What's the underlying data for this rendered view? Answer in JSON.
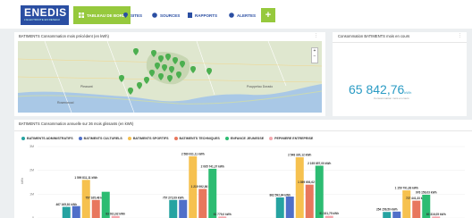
{
  "header": {
    "logo_text": "ENEDIS",
    "logo_sub": "L'ELECTRICITE EN RESEAU",
    "nav": [
      {
        "label": "TABLEAU DE BORD",
        "active": true
      },
      {
        "label": "SITES",
        "active": false
      },
      {
        "label": "SOURCES",
        "active": false
      },
      {
        "label": "RAPPORTS",
        "active": false
      },
      {
        "label": "ALERTES",
        "active": false
      }
    ],
    "add_label": "+"
  },
  "map_card": {
    "title": "BATIMENTS Consommation mois précédent (en kWh)",
    "menu": "⋮",
    "zoom_in": "+",
    "zoom_out": "−",
    "labels": {
      "l1": "Pleasant",
      "l2": "Rosenwood",
      "l3": "Pouppelau Dorado"
    }
  },
  "kpi_card": {
    "title": "Consommation BATIMENTS mois en cours",
    "menu": "⋮",
    "value": "65 842,76",
    "unit": "kWh",
    "subtitle": "Consommation mois en cours"
  },
  "chart_card": {
    "title": "BATIMENTS Consommation annuelle sur 36 mois glissants (en kWh)",
    "menu": "⋮"
  },
  "colors": {
    "brand_blue": "#2a4ea2",
    "brand_green": "#96c93d",
    "kpi": "#2a9bc4"
  },
  "chart_data": {
    "type": "bar",
    "title": "BATIMENTS Consommation annuelle sur 36 mois glissants (en kWh)",
    "ylabel": "kWh",
    "ylim": [
      0,
      3000000
    ],
    "yticks": [
      0,
      1000000,
      2000000,
      3000000
    ],
    "ytick_labels": [
      "0",
      "1M",
      "2M",
      "3M"
    ],
    "groups": 4,
    "series": [
      {
        "name": "BATIMENTS ADMINISTRATIFS",
        "color": "#26a3a1",
        "values": [
          467165.81,
          757273.09,
          862592.84,
          254155.59
        ],
        "labels": [
          "467 165,81 kWh",
          "757 272,09 kWh",
          "862 592,84 kWh",
          "254 156,59 kWh"
        ]
      },
      {
        "name": "BATIMENTS CULTURELS",
        "color": "#4f6fc9",
        "values": [
          500000,
          760000,
          900000,
          270000
        ],
        "labels": [
          "",
          "",
          "",
          ""
        ]
      },
      {
        "name": "BATIMENTS SPORTIFS",
        "color": "#f6c14f",
        "values": [
          1599811.11,
          2589811.11,
          2548320.12,
          1159791.83
        ],
        "labels": [
          "1 599 811,11 kWh",
          "2 589 811,11 kWh",
          "2 548 320,12 kWh",
          "1 159 791,83 kWh"
        ]
      },
      {
        "name": "BATIMENTS TECHNIQUES",
        "color": "#e8775d",
        "values": [
          757165.48,
          1219992.86,
          1399693.62,
          727441.33
        ],
        "labels": [
          "757 165,48 kWh",
          "1 219 992,86 kWh",
          "1 399 693,62 kWh",
          "727 441,33 kWh"
        ]
      },
      {
        "name": "ENFANCE JEUNESSE",
        "color": "#2dbc72",
        "values": [
          1100000,
          2065741.37,
          2195857.0,
          976156.0
        ],
        "labels": [
          "",
          "2 065 741,37 kWh",
          "2 195 857,00 kWh",
          "976 156,03 kWh"
        ]
      },
      {
        "name": "PEPINIERE ENTREPRISE",
        "color": "#f4a6ad",
        "values": [
          83031.0,
          61779.0,
          91331.75,
          60316.0
        ],
        "labels": [
          "83 031,62 kWh",
          "61 779,0 kWh",
          "91 331,75 kWh",
          "60 316,05 kWh"
        ]
      }
    ]
  }
}
